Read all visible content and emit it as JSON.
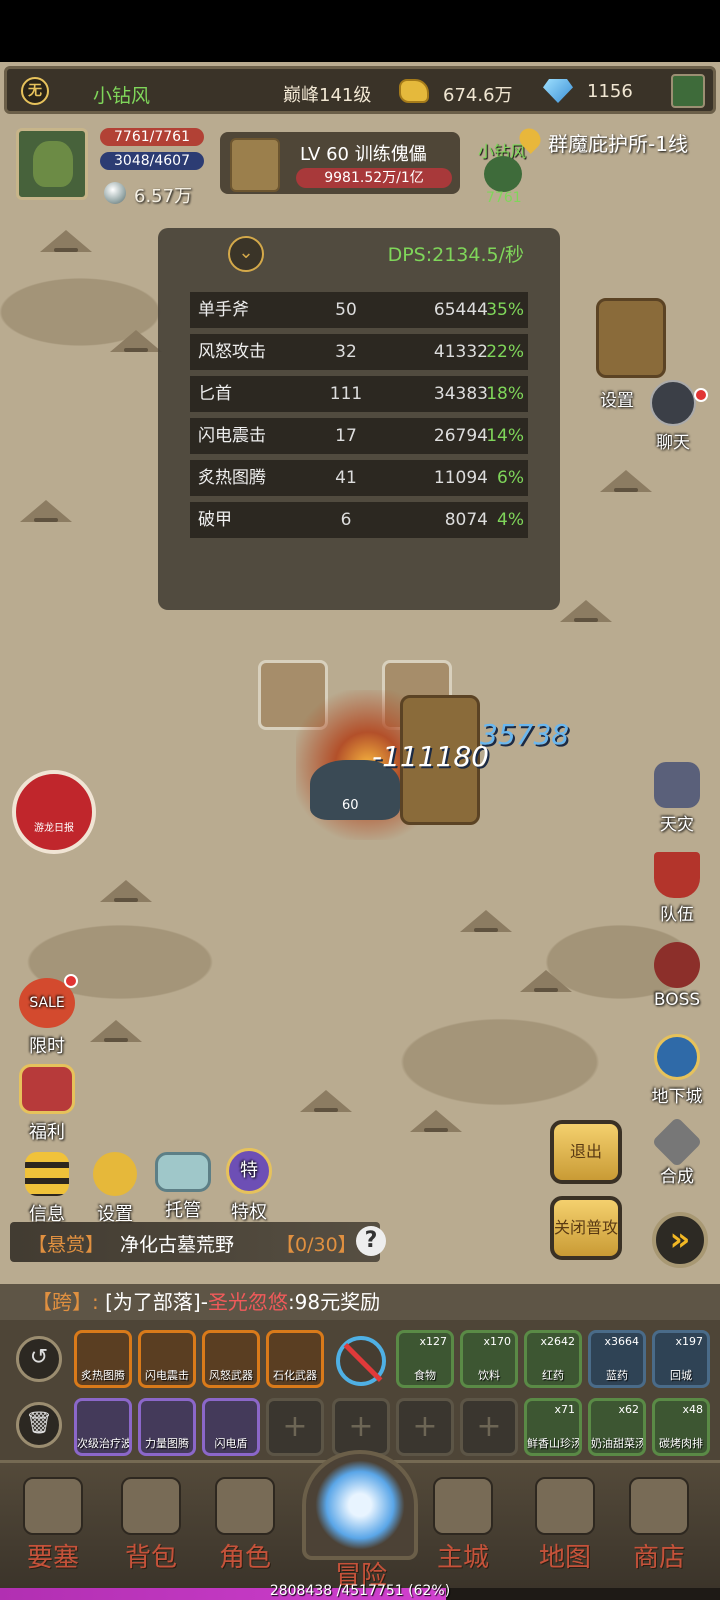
{
  "top_bar": {
    "vip_badge": "无",
    "player_name": "小钻风",
    "rank": "巅峰141级",
    "gold": "674.6万",
    "gems": "1156"
  },
  "player": {
    "hp": "7761/7761",
    "mp": "3048/4607",
    "silver": "6.57万"
  },
  "target": {
    "name": "LV 60 训练傀儡",
    "hp": "9981.52万/1亿"
  },
  "location": "群魔庇护所-1线",
  "party_member": {
    "name": "小钻风",
    "hp": "7761"
  },
  "dps_panel": {
    "total": "DPS:2134.5/秒",
    "rows": [
      {
        "skill": "单手斧",
        "hits": "50",
        "damage": "65444",
        "percent": "35%"
      },
      {
        "skill": "风怒攻击",
        "hits": "32",
        "damage": "41332",
        "percent": "22%"
      },
      {
        "skill": "匕首",
        "hits": "111",
        "damage": "34383",
        "percent": "18%"
      },
      {
        "skill": "闪电震击",
        "hits": "17",
        "damage": "26794",
        "percent": "14%"
      },
      {
        "skill": "炙热图腾",
        "hits": "41",
        "damage": "11094",
        "percent": "6%"
      },
      {
        "skill": "破甲",
        "hits": "6",
        "damage": "8074",
        "percent": "4%"
      }
    ]
  },
  "right_buttons": {
    "settings": "设置",
    "chat": "聊天",
    "calamity": "天灾",
    "team": "队伍",
    "boss": "BOSS",
    "dungeon": "地下城",
    "craft": "合成"
  },
  "battle": {
    "damage_white": "-111180",
    "damage_blue": "35738",
    "enemy_level": "60"
  },
  "dragon_logo_text": "游龙日报",
  "left_buttons": {
    "sale_badge": "SALE",
    "limited": "限时",
    "welfare": "福利",
    "info": "信息",
    "settings": "设置",
    "auto": "托管",
    "privilege": "特权",
    "privilege_icon": "特"
  },
  "action_buttons": {
    "exit": "退出",
    "close_normal_attack": "关闭普攻",
    "speed": "»"
  },
  "quest": {
    "tag": "【悬赏】",
    "title": "净化古墓荒野",
    "progress": "【0/30】",
    "help": "?"
  },
  "chat_line": {
    "tag": "【跨】",
    "separator": ":",
    "channel": "[为了部落]-",
    "user": "圣光忽悠",
    "message": ":98元奖励"
  },
  "skill_bar": {
    "row1_skills": [
      "炙热图腾",
      "闪电震击",
      "风怒武器",
      "石化武器"
    ],
    "row2_skills": [
      "次级治疗波",
      "力量图腾",
      "闪电盾"
    ],
    "consumables_top": [
      {
        "name": "食物",
        "count": "x127"
      },
      {
        "name": "饮料",
        "count": "x170"
      },
      {
        "name": "红药",
        "count": "x2642"
      },
      {
        "name": "蓝药",
        "count": "x3664"
      },
      {
        "name": "回城",
        "count": "x197"
      }
    ],
    "consumables_bottom": [
      {
        "name": "鲜香山珍汤",
        "count": "x71"
      },
      {
        "name": "奶油甜菜汤",
        "count": "x62"
      },
      {
        "name": "碳烤肉排",
        "count": "x48"
      }
    ],
    "empty_slot": "+"
  },
  "bottom_nav": [
    "要塞",
    "背包",
    "角色",
    "冒险",
    "主城",
    "地图",
    "商店"
  ],
  "xp": {
    "text": "2808438 /4517751 (62%)",
    "fraction": 0.62
  },
  "colors": {
    "accent_green": "#7fd65a",
    "accent_orange": "#e09040",
    "hp_red": "#b24135",
    "mp_blue": "#2c3c73",
    "xp_purple": "#c040c0"
  }
}
